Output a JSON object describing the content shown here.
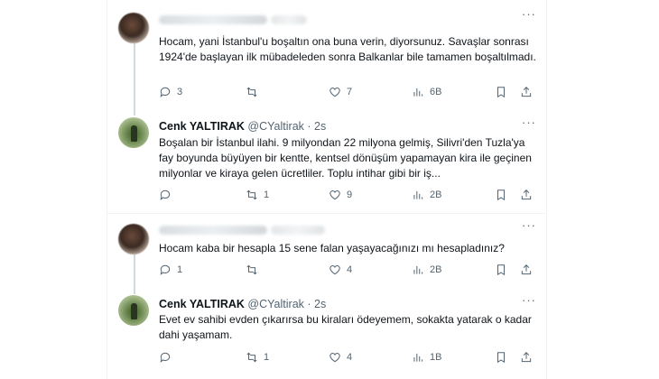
{
  "tweets": [
    {
      "author_name": "",
      "handle": "",
      "time": "",
      "text": "Hocam, yani İstanbul'u boşaltın ona buna verin, diyorsunuz. Savaşlar sonrası 1924'de başlayan ilk mübadeleden sonra Balkanlar bile tamamen boşaltılmadı.",
      "replies": "3",
      "retweets": "",
      "likes": "7",
      "views": "6B"
    },
    {
      "author_name": "Cenk YALTIRAK",
      "handle": "@CYaltirak",
      "time": "2s",
      "text": "Boşalan bir İstanbul ilahi. 9 milyondan 22 milyona gelmiş, Silivri'den Tuzla'ya fay boyunda büyüyen bir kentte, kentsel dönüşüm yapamayan kira ile geçinen milyonlar ve kiraya gelen ücretliler. Toplu intihar gibi bir iş...",
      "replies": "",
      "retweets": "1",
      "likes": "9",
      "views": "2B"
    },
    {
      "author_name": "",
      "handle": "",
      "time": "",
      "text": "Hocam kaba bir hesapla 15 sene falan yaşayacağınızı mı hesapladınız?",
      "replies": "1",
      "retweets": "",
      "likes": "4",
      "views": "2B"
    },
    {
      "author_name": "Cenk YALTIRAK",
      "handle": "@CYaltirak",
      "time": "2s",
      "text": "Evet ev sahibi evden çıkarırsa bu kiraları ödeyemem, sokakta yatarak o kadar dahi yaşamam.",
      "replies": "",
      "retweets": "1",
      "likes": "4",
      "views": "1B"
    }
  ],
  "ui": {
    "more_glyph": "···",
    "dot": "·"
  },
  "icons": [
    "reply-icon",
    "retweet-icon",
    "like-icon",
    "views-icon",
    "bookmark-icon",
    "share-icon",
    "more-icon"
  ],
  "colors": {
    "text": "#0f1419",
    "muted": "#536471",
    "border": "#eff3f4",
    "thread_line": "#cfd9de"
  }
}
